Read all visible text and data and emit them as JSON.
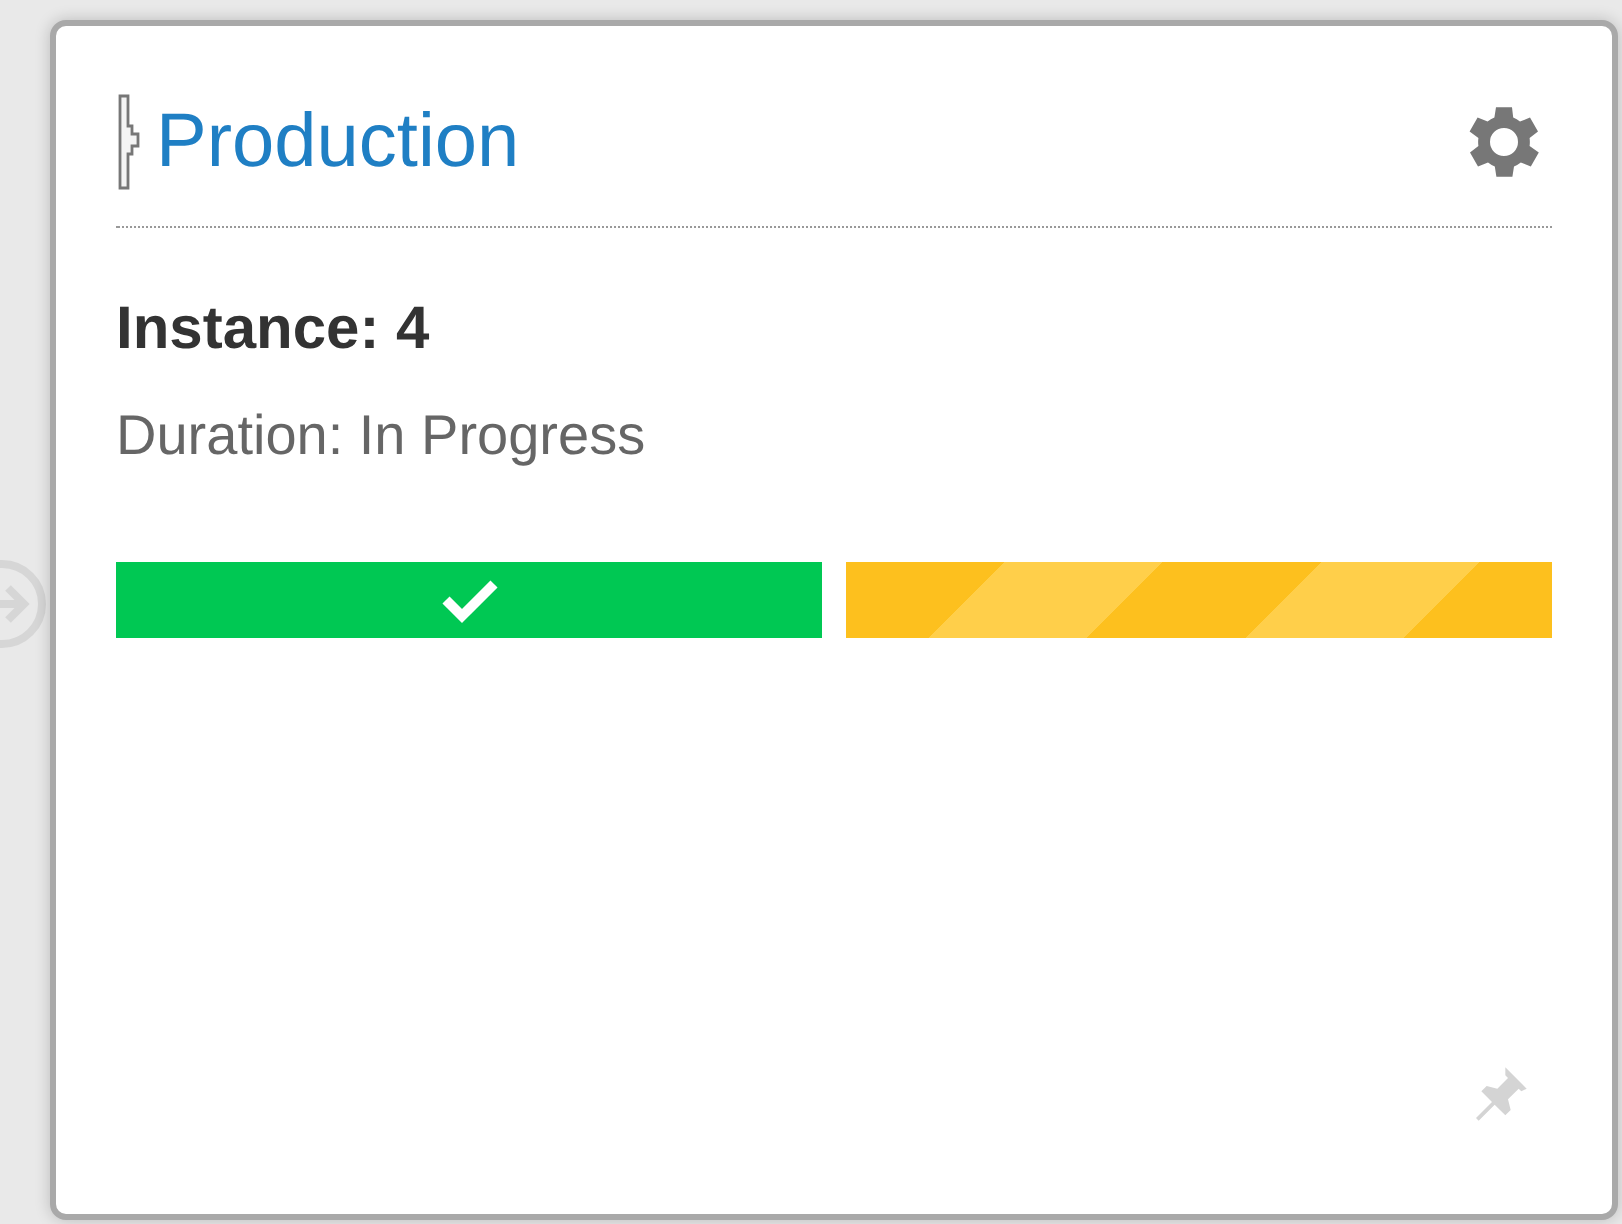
{
  "card": {
    "title": "Production",
    "instance": "Instance: 4",
    "duration": "Duration: In Progress",
    "stages": [
      {
        "kind": "complete"
      },
      {
        "kind": "in_progress"
      }
    ]
  }
}
